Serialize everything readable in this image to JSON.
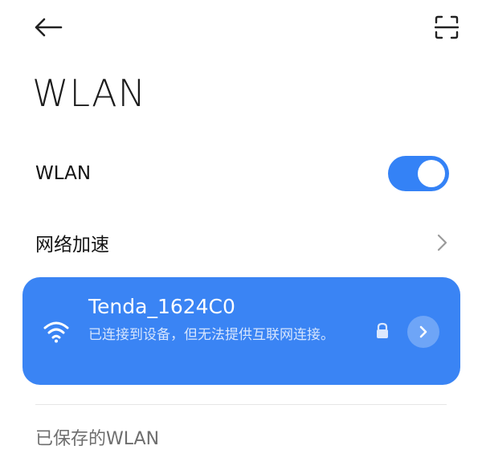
{
  "header": {
    "back_icon": "arrow-left-icon",
    "scan_icon": "scan-frame-icon"
  },
  "page": {
    "title": "WLAN"
  },
  "settings": {
    "wlan_label": "WLAN",
    "wlan_enabled": true,
    "accelerate_label": "网络加速"
  },
  "connected_network": {
    "name": "Tenda_1624C0",
    "status": "已连接到设备，但无法提供互联网连接。",
    "secured": true,
    "signal_icon": "wifi-icon"
  },
  "saved_section": {
    "title": "已保存的WLAN"
  },
  "colors": {
    "accent": "#3482f6",
    "card": "#3a84f4"
  }
}
